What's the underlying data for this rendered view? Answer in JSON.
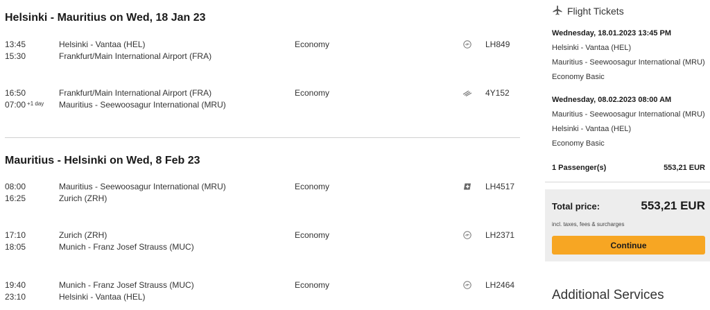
{
  "outbound": {
    "title": "Helsinki - Mauritius on Wed, 18 Jan 23",
    "segments": [
      {
        "dep_time": "13:45",
        "arr_time": "15:30",
        "arr_day_offset": "",
        "from": "Helsinki - Vantaa (HEL)",
        "to": "Frankfurt/Main International Airport (FRA)",
        "cabin": "Economy",
        "airline_icon": "lufthansa-crane-icon",
        "flight_no": "LH849"
      },
      {
        "dep_time": "16:50",
        "arr_time": "07:00",
        "arr_day_offset": "+1 day",
        "from": "Frankfurt/Main International Airport (FRA)",
        "to": "Mauritius - Seewoosagur International (MRU)",
        "cabin": "Economy",
        "airline_icon": "condor-wing-icon",
        "flight_no": "4Y152"
      }
    ]
  },
  "inbound": {
    "title": "Mauritius - Helsinki on Wed, 8 Feb 23",
    "segments": [
      {
        "dep_time": "08:00",
        "arr_time": "16:25",
        "arr_day_offset": "",
        "from": "Mauritius - Seewoosagur International (MRU)",
        "to": "Zurich (ZRH)",
        "cabin": "Economy",
        "airline_icon": "swiss-logo-icon",
        "flight_no": "LH4517"
      },
      {
        "dep_time": "17:10",
        "arr_time": "18:05",
        "arr_day_offset": "",
        "from": "Zurich (ZRH)",
        "to": "Munich - Franz Josef Strauss (MUC)",
        "cabin": "Economy",
        "airline_icon": "lufthansa-crane-icon",
        "flight_no": "LH2371"
      },
      {
        "dep_time": "19:40",
        "arr_time": "23:10",
        "arr_day_offset": "",
        "from": "Munich - Franz Josef Strauss (MUC)",
        "to": "Helsinki - Vantaa (HEL)",
        "cabin": "Economy",
        "airline_icon": "lufthansa-crane-icon",
        "flight_no": "LH2464"
      }
    ]
  },
  "sidebar": {
    "header": "Flight Tickets",
    "header_icon": "airplane-icon",
    "trips": [
      {
        "datetime": "Wednesday, 18.01.2023 13:45 PM",
        "from": "Helsinki - Vantaa (HEL)",
        "to": "Mauritius - Seewoosagur International (MRU)",
        "fare": "Economy Basic"
      },
      {
        "datetime": "Wednesday, 08.02.2023 08:00 AM",
        "from": "Mauritius - Seewoosagur International (MRU)",
        "to": "Helsinki - Vantaa (HEL)",
        "fare": "Economy Basic"
      }
    ],
    "passengers_label": "1 Passenger(s)",
    "passengers_price": "553,21 EUR",
    "total_label": "Total price:",
    "total_value": "553,21 EUR",
    "total_note": "incl. taxes, fees & surcharges",
    "continue_label": "Continue",
    "additional_services": "Additional Services"
  },
  "colors": {
    "accent": "#f7a623",
    "total_bg": "#ededed",
    "divider": "#cfcfcf"
  }
}
